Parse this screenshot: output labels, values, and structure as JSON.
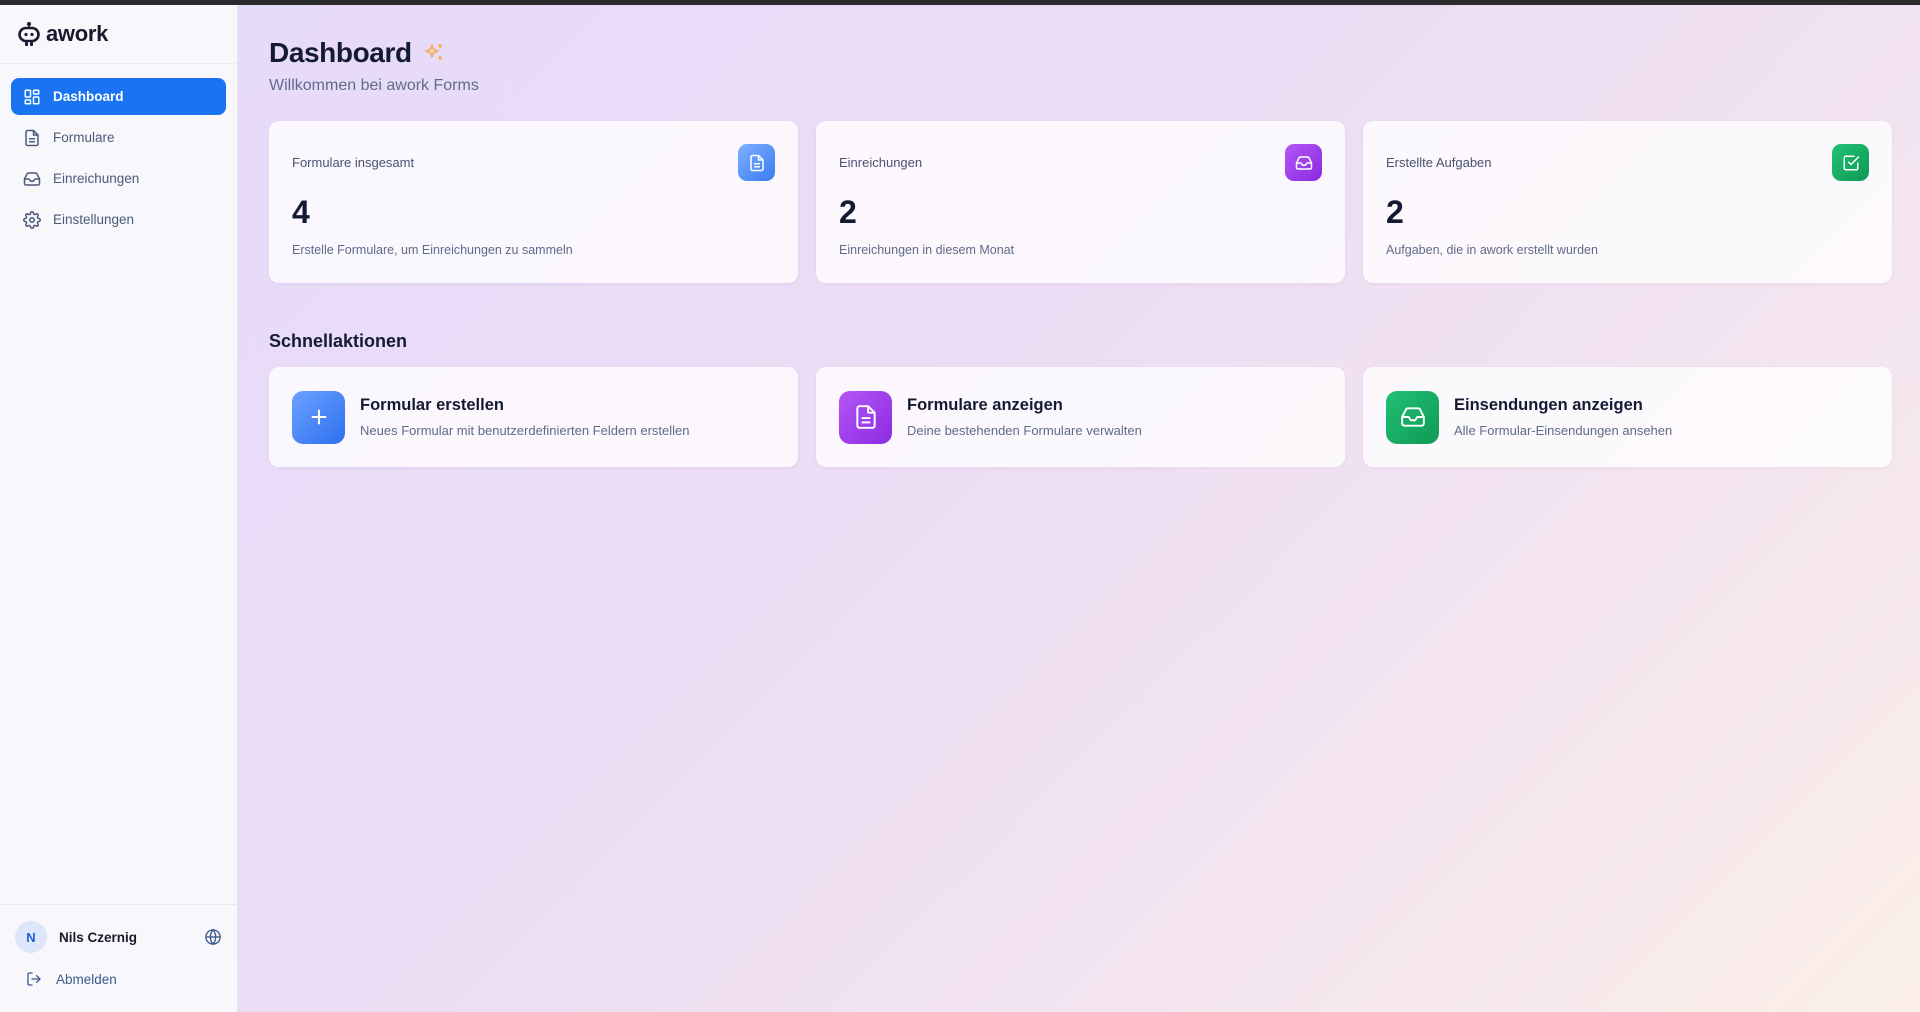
{
  "app": {
    "logo_text": "awork"
  },
  "sidebar": {
    "items": [
      {
        "label": "Dashboard",
        "icon": "dashboard-icon",
        "active": true
      },
      {
        "label": "Formulare",
        "icon": "document-icon",
        "active": false
      },
      {
        "label": "Einreichungen",
        "icon": "inbox-icon",
        "active": false
      },
      {
        "label": "Einstellungen",
        "icon": "gear-icon",
        "active": false
      }
    ],
    "user": {
      "initial": "N",
      "name": "Nils Czernig"
    },
    "logout_label": "Abmelden"
  },
  "header": {
    "title": "Dashboard",
    "subtitle": "Willkommen bei awork Forms"
  },
  "stats": [
    {
      "label": "Formulare insgesamt",
      "value": "4",
      "desc": "Erstelle Formulare, um Einreichungen zu sammeln",
      "icon": "document-icon",
      "color": "#3a7bf2"
    },
    {
      "label": "Einreichungen",
      "value": "2",
      "desc": "Einreichungen in diesem Monat",
      "icon": "inbox-icon",
      "color": "#8a2be2"
    },
    {
      "label": "Erstellte Aufgaben",
      "value": "2",
      "desc": "Aufgaben, die in awork erstellt wurden",
      "icon": "check-square-icon",
      "color": "#0e9a55"
    }
  ],
  "quick_actions": {
    "title": "Schnellaktionen",
    "items": [
      {
        "title": "Formular erstellen",
        "desc": "Neues Formular mit benutzerdefinierten Feldern erstellen",
        "icon": "plus-icon",
        "color": "#2f6ff0"
      },
      {
        "title": "Formulare anzeigen",
        "desc": "Deine bestehenden Formulare verwalten",
        "icon": "document-icon",
        "color": "#8a2be2"
      },
      {
        "title": "Einsendungen anzeigen",
        "desc": "Alle Formular-Einsendungen ansehen",
        "icon": "inbox-icon",
        "color": "#0e9a55"
      }
    ]
  },
  "colors": {
    "accent": "#1a73f0",
    "sparkle": "#f2b35a"
  }
}
